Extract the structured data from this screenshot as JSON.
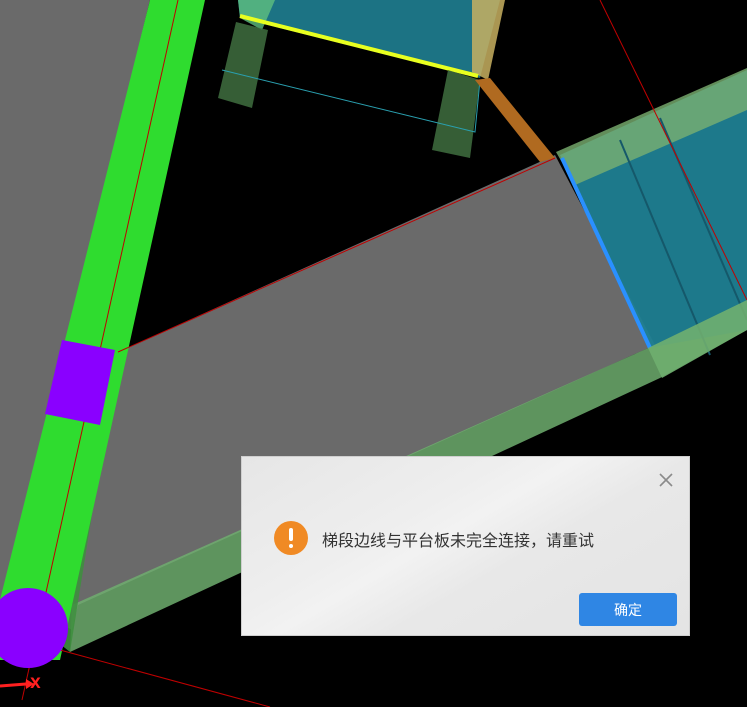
{
  "dialog": {
    "message": "梯段边线与平台板未完全连接，请重试",
    "ok_label": "确定",
    "close_icon": "close-icon",
    "warning_icon": "exclamation-circle-icon"
  },
  "viewport": {
    "axis_label": "X"
  },
  "colors": {
    "background": "#000000",
    "wall": "#2fdc2f",
    "column": "#8a00ff",
    "platform": "#6a6a6a",
    "stair_blue": "#1f7f92",
    "dialog_accent": "#2f86e4",
    "warning": "#f08a24"
  }
}
